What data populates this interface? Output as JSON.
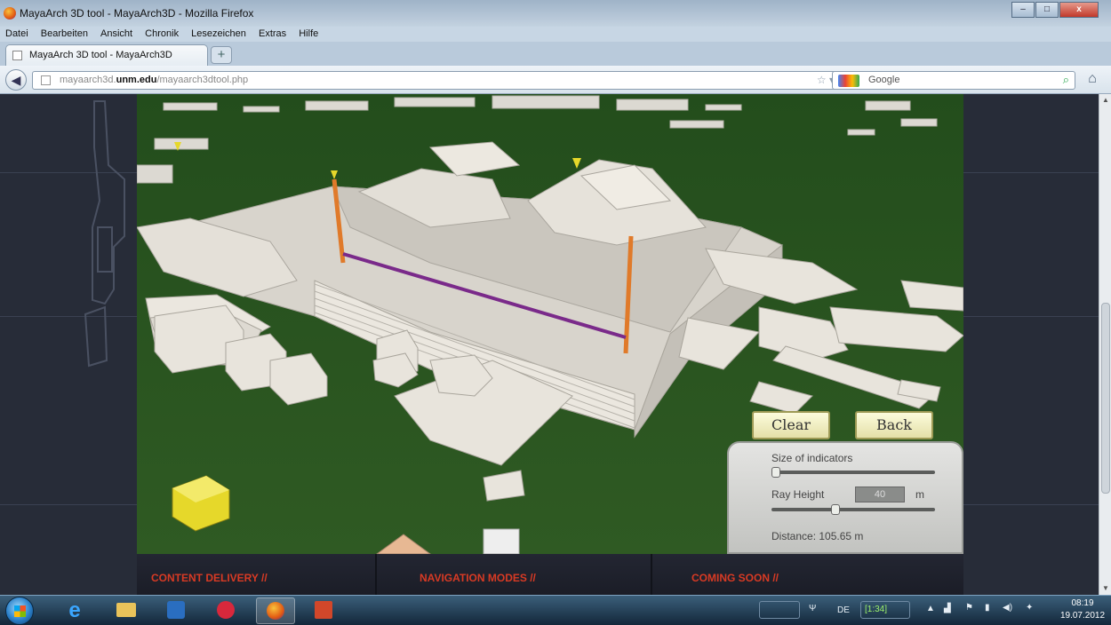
{
  "window": {
    "title": "MayaArch 3D tool - MayaArch3D - Mozilla Firefox",
    "controls": {
      "minimize": "–",
      "maximize": "□",
      "close": "x"
    }
  },
  "menu": [
    "Datei",
    "Bearbeiten",
    "Ansicht",
    "Chronik",
    "Lesezeichen",
    "Extras",
    "Hilfe"
  ],
  "tab": {
    "label": "MayaArch 3D tool - MayaArch3D",
    "new_tab": "+"
  },
  "nav": {
    "back_icon": "arrow-left-icon",
    "url_prefix": "mayaarch3d.",
    "url_host": "unm.edu",
    "url_path": "/mayaarch3dtool.php",
    "url_tools": "☆ ▾ C",
    "search_engine": "Google",
    "search_icon": "magnifier-icon",
    "home_icon": "home-icon"
  },
  "viewer": {
    "clear_button": "Clear",
    "back_button": "Back",
    "panel": {
      "size_label": "Size of indicators",
      "size_level": 0.0,
      "ray_label": "Ray Height",
      "ray_value": "40",
      "ray_unit": "m",
      "ray_level": 0.38,
      "distance_text": "Distance: 105.65 m"
    },
    "colors": {
      "ground": "#2f5a23",
      "building": "#e8e4dc",
      "ray": "#e07a2a",
      "line": "#7a2a8a",
      "cube": "#e6d82a"
    }
  },
  "bottom_nav": [
    "CONTENT DELIVERY //",
    "NAVIGATION MODES //",
    "COMING SOON //"
  ],
  "taskbar": {
    "apps": [
      "windows-start",
      "internet-explorer",
      "file-explorer",
      "media-player",
      "itunes",
      "firefox",
      "powerpoint"
    ],
    "lang": "DE",
    "battery": "[1:34]",
    "time": "08:19",
    "date": "19.07.2012"
  }
}
